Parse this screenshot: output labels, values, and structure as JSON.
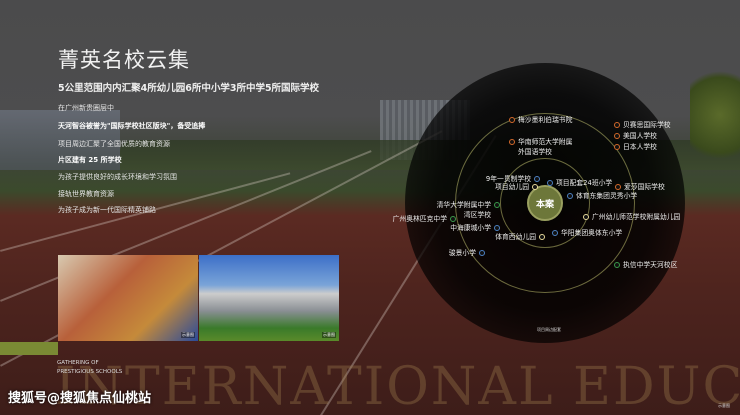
{
  "title": "菁英名校云集",
  "subtitle": "5公里范围内内汇聚4所幼儿园6所中小学3所中学5所国际学校",
  "paragraphs": [
    {
      "text": "在广州新贵圈层中",
      "bold": false
    },
    {
      "text": "天河智谷被誉为\"国际学校社区版块\"，备受追捧",
      "bold": true
    },
    {
      "text": "项目周边汇聚了全国优质的教育资源",
      "bold": false
    },
    {
      "text": "片区建有 25 所学校",
      "bold": true
    },
    {
      "text": "为孩子提供良好的成长环境和学习氛围",
      "bold": false
    },
    {
      "text": "接轨世界教育资源",
      "bold": false
    },
    {
      "text": "为孩子成为新一代国际精英铺路",
      "bold": false
    }
  ],
  "photo_tag": "示意图",
  "gathering": [
    "GATHERING OF",
    "PRESTIGIOUS SCHOOLS"
  ],
  "big_word": "INTERNATIONAL EDUCATION",
  "watermark": "搜狐号@搜狐焦点仙桃站",
  "map_caption": "项目周边配套",
  "corner_tag": "示意图",
  "center_label": "本案",
  "colors": {
    "international": "#d4692a",
    "primary": "#4d82c4",
    "kindergarten": "#e6d89a",
    "middle": "#3a9a4a"
  },
  "schools": [
    {
      "name": "梅沙墨利伯瑞书院",
      "type": "international"
    },
    {
      "name": "华南师范大学附属\n外国语学校",
      "type": "international"
    },
    {
      "name": "贝赛思国际学校",
      "type": "international"
    },
    {
      "name": "美国人学校",
      "type": "international"
    },
    {
      "name": "日本人学校",
      "type": "international"
    },
    {
      "name": "9年一贯制学校",
      "type": "primary"
    },
    {
      "name": "项目幼儿园",
      "type": "kindergarten"
    },
    {
      "name": "项目配套24班小学",
      "type": "primary"
    },
    {
      "name": "爱莎国际学校",
      "type": "international"
    },
    {
      "name": "体育东集团灵秀小学",
      "type": "primary"
    },
    {
      "name": "清华大学附属中学\n湾区学校",
      "type": "middle"
    },
    {
      "name": "广州奥林匹克中学",
      "type": "middle"
    },
    {
      "name": "广州幼儿师范学校附属幼儿园",
      "type": "kindergarten"
    },
    {
      "name": "中海康城小学",
      "type": "primary"
    },
    {
      "name": "体育西幼儿园",
      "type": "kindergarten"
    },
    {
      "name": "华阳集团奥体东小学",
      "type": "primary"
    },
    {
      "name": "骏景小学",
      "type": "primary"
    },
    {
      "name": "执信中学天河校区",
      "type": "middle"
    }
  ]
}
